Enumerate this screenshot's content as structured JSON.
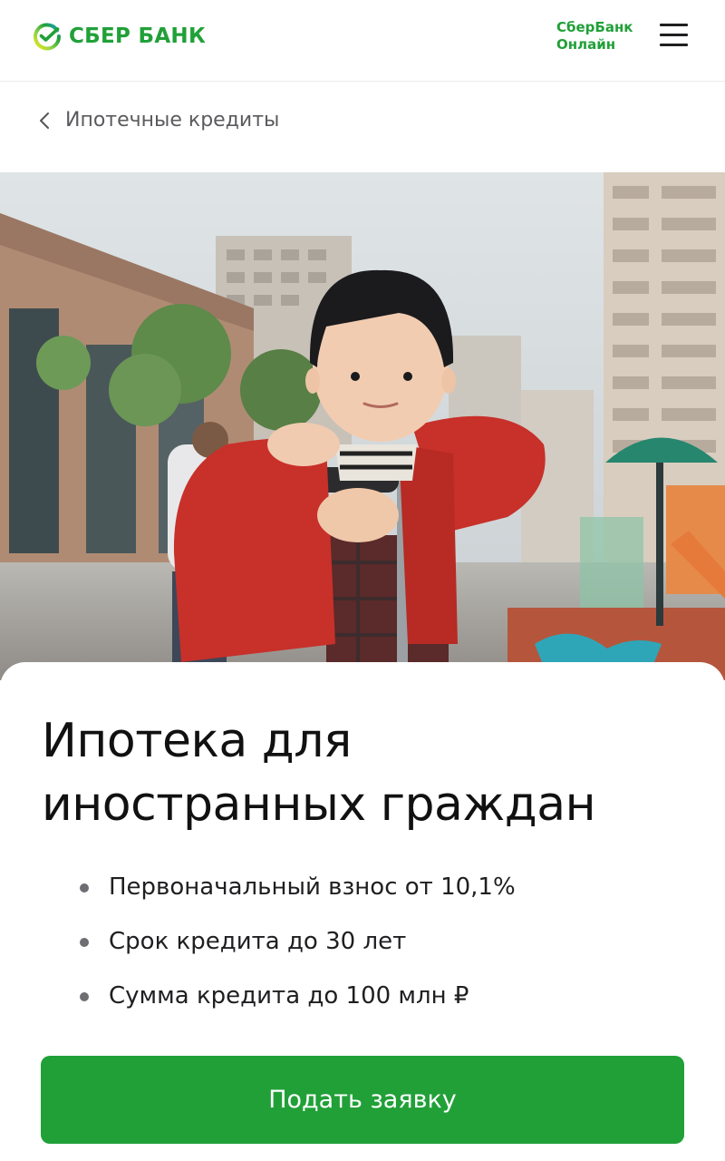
{
  "header": {
    "logo_text": "СБЕР БАНК",
    "online_link": [
      "СберБанк",
      "Онлайн"
    ]
  },
  "breadcrumb": {
    "label": "Ипотечные кредиты"
  },
  "hero": {
    "image_alt": "child-in-red-sweater-at-playground"
  },
  "card": {
    "title_lines": [
      "Ипотека для",
      "иностранных граждан"
    ],
    "features": [
      "Первоначальный взнос от 10,1%",
      "Срок кредита до 30 лет",
      "Сумма кредита до 100 млн ₽"
    ],
    "apply_label": "Подать заявку"
  },
  "colors": {
    "brand_green": "#21a038",
    "text_dark": "#1f1f22",
    "muted": "#5b5b5f"
  },
  "icons": {
    "logo": "sber-logo-icon",
    "menu": "burger-menu-icon",
    "back": "chevron-left-icon"
  }
}
